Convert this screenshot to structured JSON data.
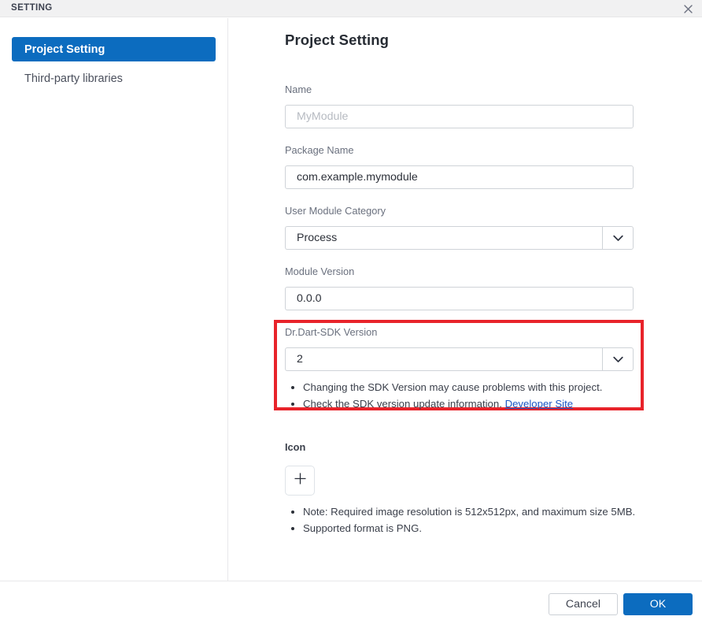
{
  "window": {
    "title": "SETTING",
    "close_icon": "close-icon"
  },
  "sidebar": {
    "items": [
      {
        "label": "Project Setting",
        "active": true
      },
      {
        "label": "Third-party libraries",
        "active": false
      }
    ]
  },
  "main": {
    "page_title": "Project Setting",
    "fields": {
      "name": {
        "label": "Name",
        "value": "",
        "placeholder": "MyModule"
      },
      "package_name": {
        "label": "Package Name",
        "value": "com.example.mymodule"
      },
      "user_module_category": {
        "label": "User Module Category",
        "value": "Process",
        "arrow_icon": "chevron-down-icon"
      },
      "module_version": {
        "label": "Module Version",
        "value": "0.0.0"
      },
      "sdk_version": {
        "label": "Dr.Dart-SDK Version",
        "value": "2",
        "arrow_icon": "chevron-down-icon",
        "notes": [
          "Changing the SDK Version may cause problems with this project.",
          "Check the SDK version update information."
        ],
        "link_label": "Developer Site",
        "highlight_color": "#e8232a"
      },
      "icon": {
        "label": "Icon",
        "add_icon": "plus-icon",
        "notes": [
          "Note: Required image resolution is 512x512px, and maximum size 5MB.",
          "Supported format is PNG."
        ]
      }
    }
  },
  "footer": {
    "cancel_label": "Cancel",
    "ok_label": "OK"
  },
  "colors": {
    "accent": "#0c6cbf",
    "highlight": "#e8232a",
    "link": "#1a56c4"
  }
}
